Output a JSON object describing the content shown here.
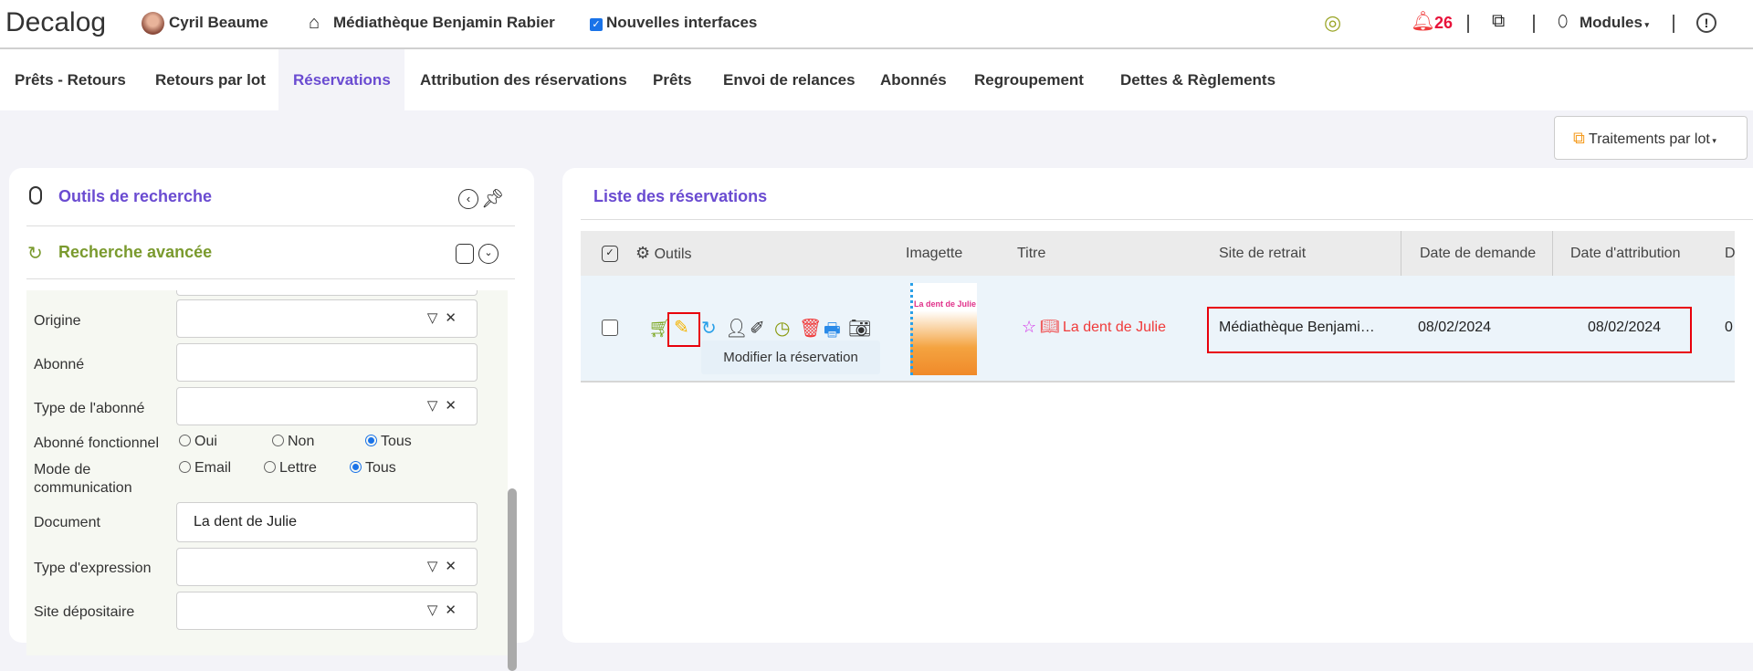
{
  "header": {
    "logo": "Decalog",
    "user": "Cyril Beaume",
    "library": "Médiathèque Benjamin Rabier",
    "new_ui_label": "Nouvelles interfaces",
    "new_ui_checked": true,
    "notifications": "26",
    "modules": "Modules"
  },
  "tabs": [
    {
      "label": "Prêts - Retours"
    },
    {
      "label": "Retours par lot"
    },
    {
      "label": "Réservations",
      "active": true
    },
    {
      "label": "Attribution des réservations"
    },
    {
      "label": "Prêts"
    },
    {
      "label": "Envoi de relances"
    },
    {
      "label": "Abonnés"
    },
    {
      "label": "Regroupement"
    },
    {
      "label": "Dettes & Règlements"
    }
  ],
  "toolbar": {
    "batch": "Traitements par lot"
  },
  "search": {
    "title": "Outils de recherche",
    "advanced": "Recherche avancée",
    "fields": {
      "origine": "Origine",
      "abonne": "Abonné",
      "type_abonne": "Type de l'abonné",
      "abonne_fonctionnel": "Abonné fonctionnel",
      "mode_communication": "Mode de communication",
      "document": "Document",
      "document_value": "La dent de Julie",
      "type_expression": "Type d'expression",
      "site_depositaire": "Site dépositaire"
    },
    "radios1": [
      "Oui",
      "Non",
      "Tous"
    ],
    "radios1_selected": "Tous",
    "radios2": [
      "Email",
      "Lettre",
      "Tous"
    ],
    "radios2_selected": "Tous"
  },
  "list": {
    "title": "Liste des réservations",
    "columns": {
      "tools": "Outils",
      "thumb": "Imagette",
      "title": "Titre",
      "site": "Site de retrait",
      "date_request": "Date de demande",
      "date_attrib": "Date d'attribution",
      "more": "D"
    },
    "rows": [
      {
        "thumb_text": "La dent de Julie",
        "title": "La dent de Julie",
        "site": "Médiathèque Benjami…",
        "date_request": "08/02/2024",
        "date_attrib": "08/02/2024",
        "more": "0"
      }
    ],
    "tooltip": "Modifier la réservation"
  },
  "colors": {
    "accent": "#6a4bd1",
    "green": "#7a9a2e",
    "red": "#f03a3a",
    "highlight": "#e8000b"
  }
}
